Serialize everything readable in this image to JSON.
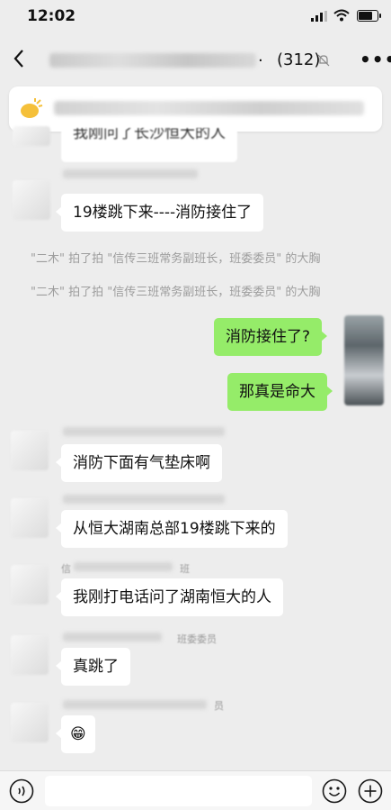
{
  "status_bar": {
    "time": "12:02"
  },
  "header": {
    "title_suffix": ".",
    "member_count": "(312)"
  },
  "messages": [
    {
      "text": "我刚问了长沙恒大的人"
    },
    {
      "text": "19楼跳下来----消防接住了"
    },
    {
      "text": "\"二木\" 拍了拍 \"信传三班常务副班长，班委委员\" 的大胸"
    },
    {
      "text": "\"二木\" 拍了拍 \"信传三班常务副班长，班委委员\" 的大胸"
    },
    {
      "text": "消防接住了?"
    },
    {
      "text": "那真是命大"
    },
    {
      "text": "消防下面有气垫床啊"
    },
    {
      "text": "从恒大湖南总部19楼跳下来的"
    },
    {
      "text": "我刚打电话问了湖南恒大的人"
    },
    {
      "text": "真跳了"
    },
    {
      "text": "😁"
    }
  ],
  "nick_fragments": {
    "n1": "信",
    "n2": "班",
    "n3": "班委委员",
    "n4": "员"
  },
  "colors": {
    "background": "#ededed",
    "bubble_in": "#ffffff",
    "bubble_out": "#95ec69",
    "system_text": "#9d9d9d"
  },
  "icons": [
    "back-chevron-icon",
    "mute-bell-icon",
    "more-dots-icon",
    "announcement-icon",
    "voice-icon",
    "emoji-icon",
    "plus-icon"
  ]
}
